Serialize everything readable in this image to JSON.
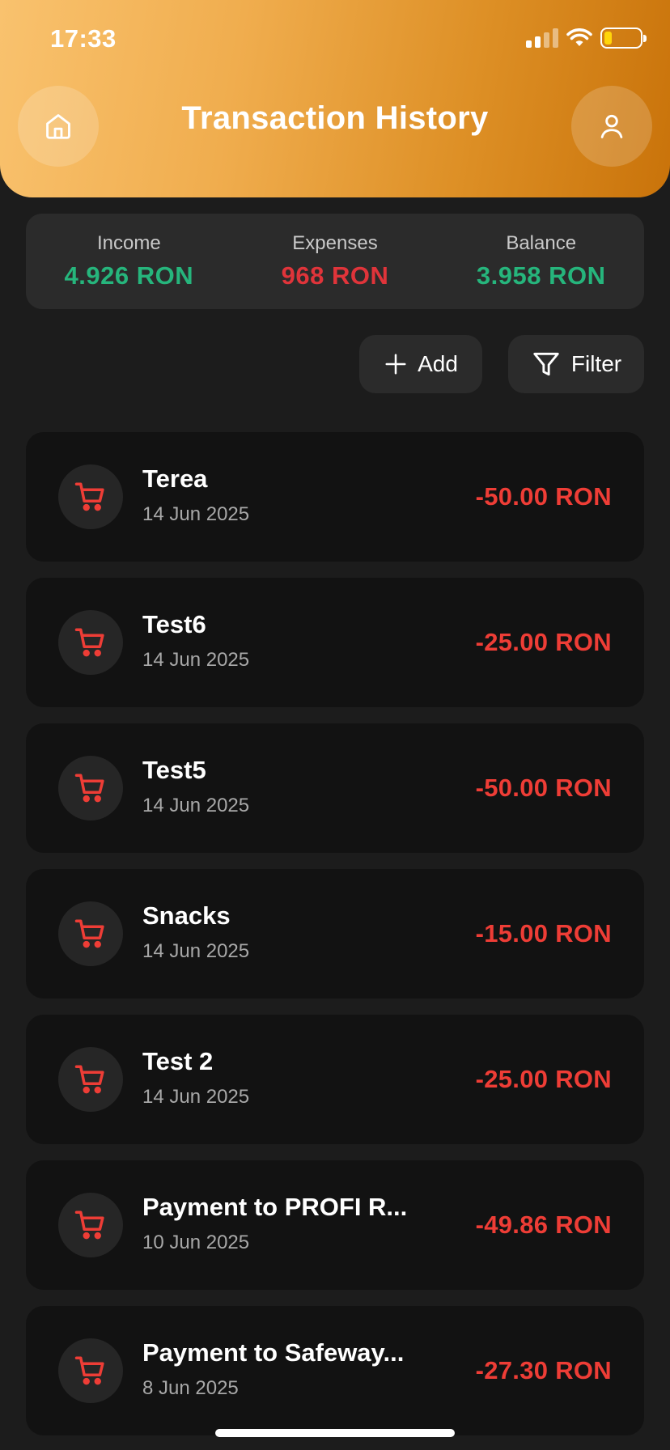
{
  "status": {
    "time": "17:33"
  },
  "header": {
    "title": "Transaction History"
  },
  "summary": {
    "income_label": "Income",
    "income_value": "4.926 RON",
    "expenses_label": "Expenses",
    "expenses_value": "968 RON",
    "balance_label": "Balance",
    "balance_value": "3.958 RON"
  },
  "actions": {
    "add_label": "Add",
    "filter_label": "Filter"
  },
  "transactions": [
    {
      "name": "Terea",
      "date": "14 Jun 2025",
      "amount": "-50.00 RON"
    },
    {
      "name": "Test6",
      "date": "14 Jun 2025",
      "amount": "-25.00 RON"
    },
    {
      "name": "Test5",
      "date": "14 Jun 2025",
      "amount": "-50.00 RON"
    },
    {
      "name": "Snacks",
      "date": "14 Jun 2025",
      "amount": "-15.00 RON"
    },
    {
      "name": "Test 2",
      "date": "14 Jun 2025",
      "amount": "-25.00 RON"
    },
    {
      "name": "Payment to PROFI R...",
      "date": "10 Jun 2025",
      "amount": "-49.86 RON"
    },
    {
      "name": "Payment to Safeway...",
      "date": "8 Jun 2025",
      "amount": "-27.30 RON"
    }
  ],
  "colors": {
    "income": "#26b57c",
    "expense": "#e0343a",
    "amount": "#ee3d36",
    "accent": "#f0ad4e"
  },
  "icons": {
    "home": "home-icon",
    "profile": "user-icon",
    "add": "plus-icon",
    "filter": "filter-icon",
    "transaction": "shopping-cart-icon"
  }
}
